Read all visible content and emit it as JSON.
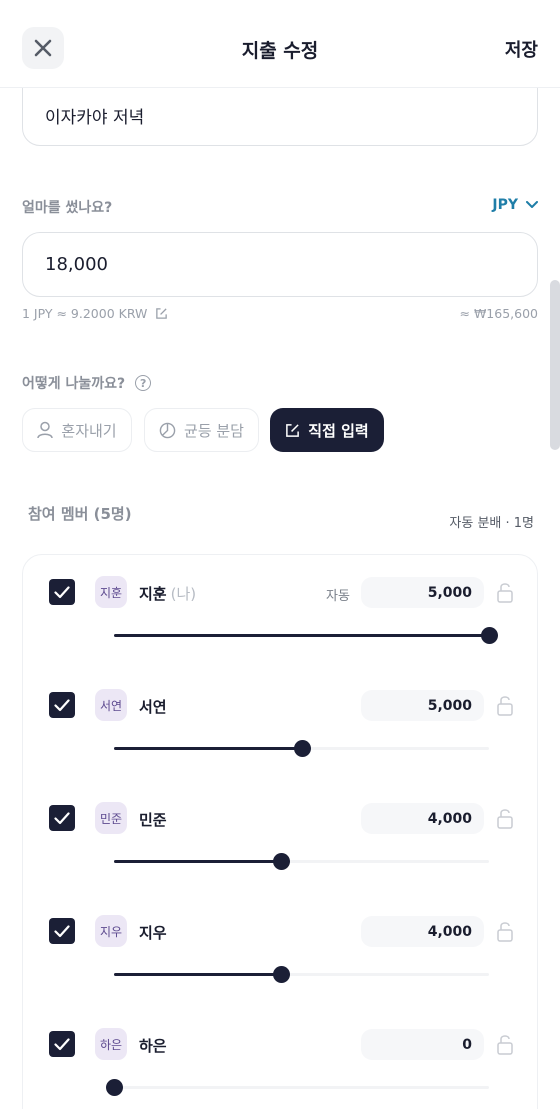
{
  "header": {
    "title": "지출 수정",
    "save_label": "저장",
    "close_icon": "close-icon"
  },
  "title_field": {
    "value": "이자카야 저녁"
  },
  "amount": {
    "label": "얼마를 썼나요?",
    "currency": "JPY",
    "value": "18,000",
    "rate": "1 JPY ≈ 9.2000 KRW",
    "converted": "≈ ₩165,600"
  },
  "split": {
    "label": "어떻게 나눌까요?",
    "help": "?",
    "options": [
      {
        "label": "혼자내기",
        "icon": "person-icon",
        "selected": false
      },
      {
        "label": "균등 분담",
        "icon": "pie-icon",
        "selected": false
      },
      {
        "label": "직접 입력",
        "icon": "edit-icon",
        "selected": true
      }
    ]
  },
  "members": {
    "title": "참여 멤버 (5명)",
    "auto_info": "자동 분배 · 1명",
    "list": [
      {
        "avatar": "지훈",
        "name": "지훈",
        "me": "(나)",
        "auto": "자동",
        "amount": "5,000",
        "checked": true,
        "share": 1.0
      },
      {
        "avatar": "서연",
        "name": "서연",
        "me": "",
        "auto": "",
        "amount": "5,000",
        "checked": true,
        "share": 0.5
      },
      {
        "avatar": "민준",
        "name": "민준",
        "me": "",
        "auto": "",
        "amount": "4,000",
        "checked": true,
        "share": 0.445
      },
      {
        "avatar": "지우",
        "name": "지우",
        "me": "",
        "auto": "",
        "amount": "4,000",
        "checked": true,
        "share": 0.445
      },
      {
        "avatar": "하은",
        "name": "하은",
        "me": "",
        "auto": "",
        "amount": "0",
        "checked": true,
        "share": 0.0
      }
    ]
  },
  "colors": {
    "primary": "#1b1f36",
    "accent": "#1f7ea8",
    "avatar_bg": "#ece7f5"
  }
}
